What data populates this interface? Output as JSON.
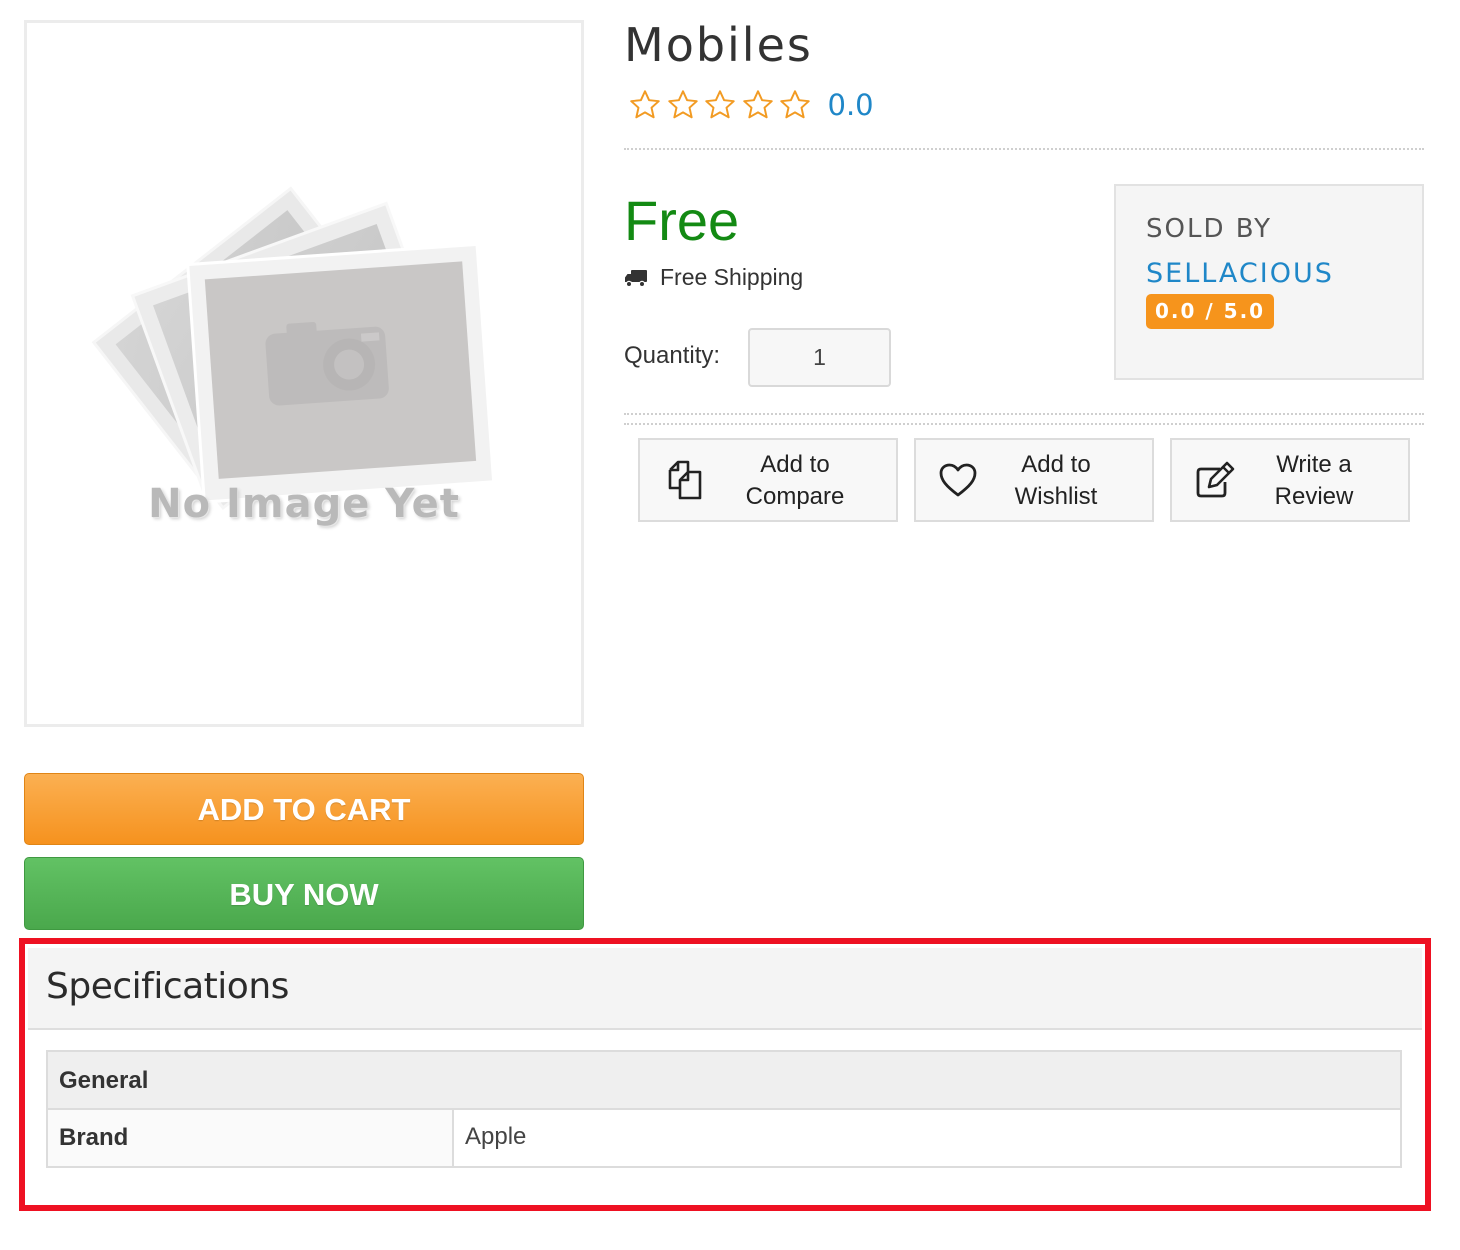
{
  "product": {
    "image_placeholder_text": "No Image Yet",
    "title": "Mobiles",
    "rating_value": "0.0",
    "rating_stars": 0,
    "price": "Free",
    "shipping": "Free Shipping",
    "quantity_label": "Quantity:",
    "quantity_value": "1"
  },
  "seller": {
    "sold_by_label": "SOLD BY",
    "name": "SELLACIOUS",
    "rating": "0.0 / 5.0"
  },
  "buttons": {
    "add_to_cart": "ADD TO CART",
    "buy_now": "BUY NOW"
  },
  "actions": {
    "compare": {
      "line1": "Add to",
      "line2": "Compare",
      "icon": "compare-icon"
    },
    "wishlist": {
      "line1": "Add to",
      "line2": "Wishlist",
      "icon": "heart-icon"
    },
    "review": {
      "line1": "Write a",
      "line2": "Review",
      "icon": "edit-icon"
    }
  },
  "specifications": {
    "title": "Specifications",
    "group": "General",
    "rows": [
      {
        "key": "Brand",
        "value": "Apple"
      }
    ]
  },
  "colors": {
    "price_green": "#138a13",
    "link_blue": "#1f87c8",
    "cart_orange": "#f6921e",
    "buy_green": "#4aa84c",
    "star_orange": "#f29b23",
    "highlight_red": "#ee1122"
  }
}
